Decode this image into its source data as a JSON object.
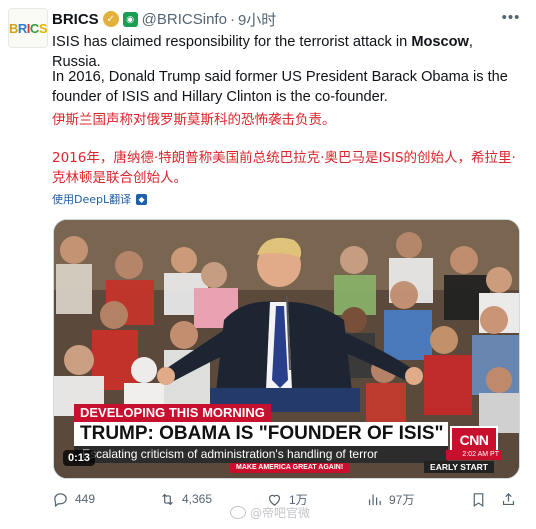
{
  "account": {
    "avatar_text": "BRICS",
    "name": "BRICS",
    "handle": "@BRICSinfo",
    "separator": "·",
    "time": "9小时"
  },
  "tweet": {
    "text1_pre": "ISIS has claimed responsibility for the terrorist attack in ",
    "text1_bold": "Moscow",
    "text1_post": ", Russia.",
    "text2": "In 2016, Donald Trump said former US President Barack Obama is the founder of ISIS and Hillary Clinton is the co-founder.",
    "translation1": "伊斯兰国声称对俄罗斯莫斯科的恐怖袭击负责。",
    "translation2": "2016年，唐纳德·特朗普称美国前总统巴拉克·奥巴马是ISIS的创始人，希拉里·克林顿是联合创始人。",
    "translate_link": "使用DeepL翻译"
  },
  "video": {
    "banner": "DEVELOPING THIS MORNING",
    "headline": "TRUMP: OBAMA IS \"FOUNDER OF ISIS\"",
    "subline": "Escalating criticism of administration's handling of terror",
    "slogan": "MAKE AMERICA GREAT AGAIN!",
    "network": "CNN",
    "clock": "2:02 AM PT",
    "segment": "EARLY START",
    "podium_text": "MP",
    "duration": "0:13"
  },
  "actions": {
    "replies": "449",
    "retweets": "4,365",
    "likes": "1万",
    "views": "97万"
  },
  "watermark": "@帝吧官微",
  "colors": {
    "translation_red": "#d9262c",
    "link_blue": "#1d5fa8",
    "muted": "#536471",
    "news_red": "#c8102e"
  }
}
